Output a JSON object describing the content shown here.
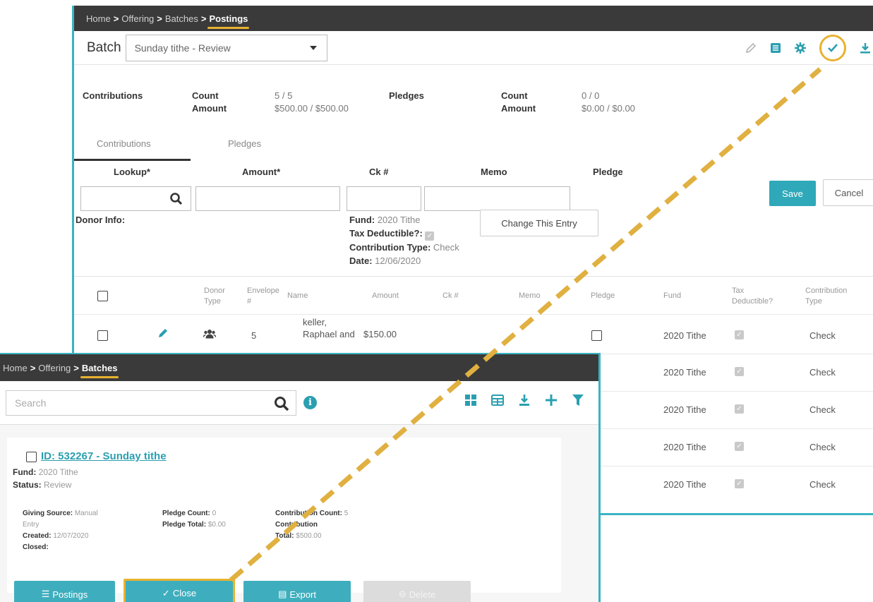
{
  "postings": {
    "breadcrumb": [
      "Home",
      "Offering",
      "Batches",
      "Postings"
    ],
    "batch_label": "Batch",
    "batch_selected": "Sunday tithe - Review",
    "toolbar_icons": [
      "pencil-icon",
      "table-icon",
      "gear-icon",
      "check-icon",
      "download-icon"
    ],
    "summary": {
      "contributions_label": "Contributions",
      "count_label": "Count",
      "amount_label": "Amount",
      "contrib_count": "5 / 5",
      "contrib_amount": "$500.00 / $500.00",
      "pledges_label": "Pledges",
      "pledge_count": "0 / 0",
      "pledge_amount": "$0.00 / $0.00"
    },
    "tabs": [
      "Contributions",
      "Pledges"
    ],
    "form": {
      "lookup_label": "Lookup*",
      "amount_label": "Amount*",
      "ck_label": "Ck #",
      "memo_label": "Memo",
      "pledge_label": "Pledge",
      "save": "Save",
      "cancel": "Cancel",
      "donor_info": "Donor Info:",
      "fund_key": "Fund:",
      "fund_val": "2020 Tithe",
      "tax_key": "Tax Deductible?:",
      "type_key": "Contribution Type:",
      "type_val": "Check",
      "date_key": "Date:",
      "date_val": "12/06/2020",
      "change_entry": "Change This Entry"
    },
    "columns": {
      "donor_type": [
        "Donor",
        "Type"
      ],
      "envelope": [
        "Envelope",
        "#"
      ],
      "name": "Name",
      "amount": "Amount",
      "ck": "Ck #",
      "memo": "Memo",
      "pledge": "Pledge",
      "fund": "Fund",
      "tax": [
        "Tax",
        "Deductible?"
      ],
      "ctype": [
        "Contribution",
        "Type"
      ]
    },
    "rows": [
      {
        "envelope": "5",
        "name": [
          "keller,",
          "Raphael and"
        ],
        "amount": "$150.00",
        "fund": "2020 Tithe",
        "type": "Check"
      },
      {
        "fund": "2020 Tithe",
        "type": "Check"
      },
      {
        "fund": "2020 Tithe",
        "type": "Check"
      },
      {
        "fund": "2020 Tithe",
        "type": "Check"
      },
      {
        "fund": "2020 Tithe",
        "type": "Check"
      }
    ]
  },
  "batches": {
    "breadcrumb": [
      "Home",
      "Offering",
      "Batches"
    ],
    "search_placeholder": "Search",
    "tool_icons": [
      "grid-icon",
      "table-icon",
      "download-icon",
      "plus-icon",
      "filter-icon"
    ],
    "card": {
      "title": "ID: 532267 - Sunday tithe",
      "fund_key": "Fund:",
      "fund_val": "2020 Tithe",
      "status_key": "Status:",
      "status_val": "Review",
      "giving_source_key": "Giving Source:",
      "giving_source_val_1": "Manual",
      "giving_source_val_2": "Entry",
      "created_key": "Created:",
      "created_val": "12/07/2020",
      "closed_key": "Closed:",
      "pledge_count_key": "Pledge Count:",
      "pledge_count_val": "0",
      "pledge_total_key": "Pledge Total:",
      "pledge_total_val": "$0.00",
      "contrib_count_key": "Contribution Count:",
      "contrib_count_val": "5",
      "contrib_total_key_1": "Contribution",
      "contrib_total_key_2": "Total:",
      "contrib_total_val": "$500.00"
    },
    "buttons": {
      "postings": "Postings",
      "close": "Close",
      "export": "Export",
      "delete": "Delete"
    }
  },
  "colors": {
    "accent": "#2fa8b9",
    "highlight": "#e8b230",
    "topbar": "#3a3a3a"
  }
}
